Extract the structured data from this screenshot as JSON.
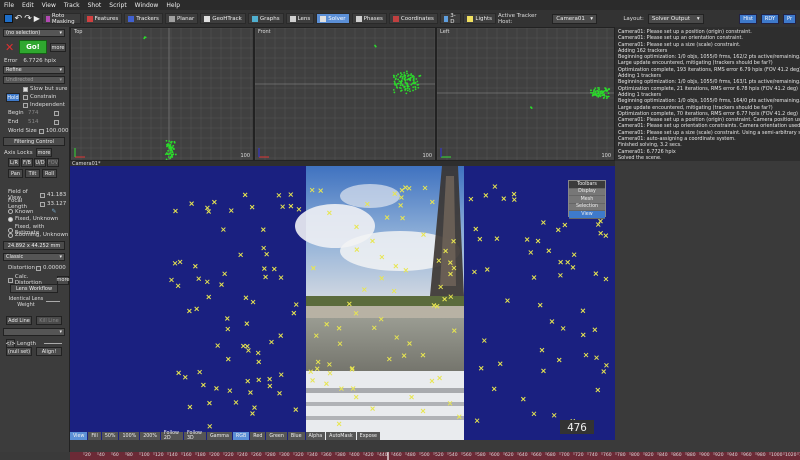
{
  "menu": [
    "File",
    "Edit",
    "View",
    "Track",
    "Shot",
    "Script",
    "Window",
    "Help"
  ],
  "toolbar": {
    "rooms": [
      {
        "label": "Roto Masking",
        "color": "#b34ab3"
      },
      {
        "label": "Features",
        "color": "#d04040"
      },
      {
        "label": "Trackers",
        "color": "#4060d0"
      },
      {
        "label": "Planar",
        "color": "#a0a0a0"
      },
      {
        "label": "GeoHTrack",
        "color": "#e0e0e0"
      },
      {
        "label": "Graphs",
        "color": "#50b0d0"
      },
      {
        "label": "Lens",
        "color": "#d0d0d0"
      },
      {
        "label": "Solver",
        "color": "#e0e0e0"
      },
      {
        "label": "Phases",
        "color": "#d0d0d0"
      },
      {
        "label": "Coordinates",
        "color": "#c04040"
      },
      {
        "label": "3-D",
        "color": "#60a0e0"
      },
      {
        "label": "Lights",
        "color": "#f0e060"
      }
    ],
    "active_room": "Solver",
    "active_tracker_host_label": "Active Tracker Host:",
    "active_tracker_host_value": "Camera01",
    "layout_label": "Layout:",
    "layout_value": "Solver Output",
    "right_buttons": [
      "Hist",
      "RDY",
      "Pr"
    ]
  },
  "left": {
    "selection": "(no selection)",
    "go": "Go!",
    "more": "more",
    "error_label": "Error",
    "error_value": "6.7726 hpix",
    "refine": "Refine",
    "undirected": "Undirected",
    "slow_but_sure": "Slow but sure",
    "constrain": "Constrain",
    "independent": "Independent",
    "hold": "Hold",
    "begin_label": "Begin",
    "begin_value": "774",
    "end_label": "End",
    "end_value": "514",
    "world_size_label": "World Size",
    "world_size_value": "100.000",
    "filtering_control": "Filtering Control",
    "axis_locks": "Axis Locks",
    "axis_more": "more",
    "axis_row1": [
      "L/R",
      "F/B",
      "U/D",
      "FOV"
    ],
    "axis_row2": [
      "Pan",
      "Tilt",
      "Roll"
    ],
    "fov_label": "Field of View",
    "fov_value": "41.183",
    "focal_label": "Focal Length",
    "focal_value": "33.127",
    "radio_known": "Known",
    "radio_fixed_unknown": "Fixed, Unknown",
    "radio_fixed_estimate": "Fixed, with Estimate",
    "radio_zooming": "Zooming, Unknown",
    "sensor_size": "24.892 x 44.252 mm",
    "lens_model": "Classic",
    "distortion_label": "Distortion",
    "distortion_value": "0.00000",
    "calc_distortion": "Calc. Distortion",
    "calc_more": "more",
    "lens_workflow": "Lens Workflow",
    "identical_lens": "Identical Lens Weight",
    "add_line": "Add Line",
    "kill_line": "Kill Line",
    "length_label": "Length",
    "null_set": "(null set)",
    "align": "Align!"
  },
  "viewports": {
    "top": {
      "label": "Top",
      "scale": "100"
    },
    "front": {
      "label": "Front",
      "scale": "100"
    },
    "left": {
      "label": "Left",
      "scale": "100"
    },
    "camera": {
      "label": "Camera01*"
    }
  },
  "log": [
    "Camera01: Please set up a position (origin) constraint.",
    "Camera01: Please set up an orientation constraint.",
    "Camera01: Please set up a size (scale) constraint.",
    "Adding 162 trackers",
    "Beginning optimization: 1/0 objs, 1055/0 frms, 162/2 pts active/remaining.",
    "Large update encountered, mitigating (trackers should be far?)",
    "Optimization complete, 193 iterations, RMS error 6.79 hpix (FOV 41.2 deg)",
    "Adding 1 trackers",
    "Beginning optimization: 1/0 objs, 1055/0 frms, 163/1 pts active/remaining.",
    "Optimization complete, 21 iterations, RMS error 6.78 hpix (FOV 41.2 deg)",
    "Adding 1 trackers",
    "Beginning optimization: 1/0 objs, 1055/0 frms, 164/0 pts active/remaining.",
    "Large update encountered, mitigating (trackers should be far?)",
    "Optimization complete, 70 iterations, RMS error 6.77 hpix (FOV 41.2 deg)",
    "Camera01: Please set up a position (origin) constraint. Camera position used temporari",
    "Camera01: Please set up orientation constraints. Camera orientation used temporari",
    "Camera01: Please set up a size (scale) constraint. Using a semi-arbitrary size.",
    "Camera01: auto-assigning a coordinate system.",
    "Finished solving, 3.2 secs.",
    "Camera01: 6.7726 hpix",
    "Solved the scene."
  ],
  "toolbars_box": [
    "Toolbars",
    "Display",
    "Mesh",
    "Selection",
    "View"
  ],
  "frame": "476",
  "bottom_buttons": [
    "View",
    "Fill",
    "50%",
    "100%",
    "200%",
    "Follow 2D",
    "Follow 3D",
    "Gamma",
    "RGB",
    "Red",
    "Green",
    "Blue",
    "Alpha",
    "AutoMask",
    "Expose"
  ],
  "timeline_ticks": [
    "20",
    "40",
    "60",
    "80",
    "100",
    "120",
    "140",
    "160",
    "180",
    "200",
    "220",
    "240",
    "260",
    "280",
    "300",
    "320",
    "340",
    "360",
    "380",
    "400",
    "420",
    "440",
    "460",
    "480",
    "500",
    "520",
    "540",
    "560",
    "580",
    "600",
    "620",
    "640",
    "660",
    "680",
    "700",
    "720",
    "740",
    "760",
    "780",
    "800",
    "820",
    "840",
    "860",
    "880",
    "900",
    "920",
    "940",
    "960",
    "980",
    "1000",
    "1020",
    "1040"
  ],
  "colors": {
    "accent": "#5b8fd6",
    "tracker": "#2bdc2b",
    "camera_bg": "#1a2080",
    "go": "#2fa82f",
    "timeline": "#6b2a36"
  }
}
